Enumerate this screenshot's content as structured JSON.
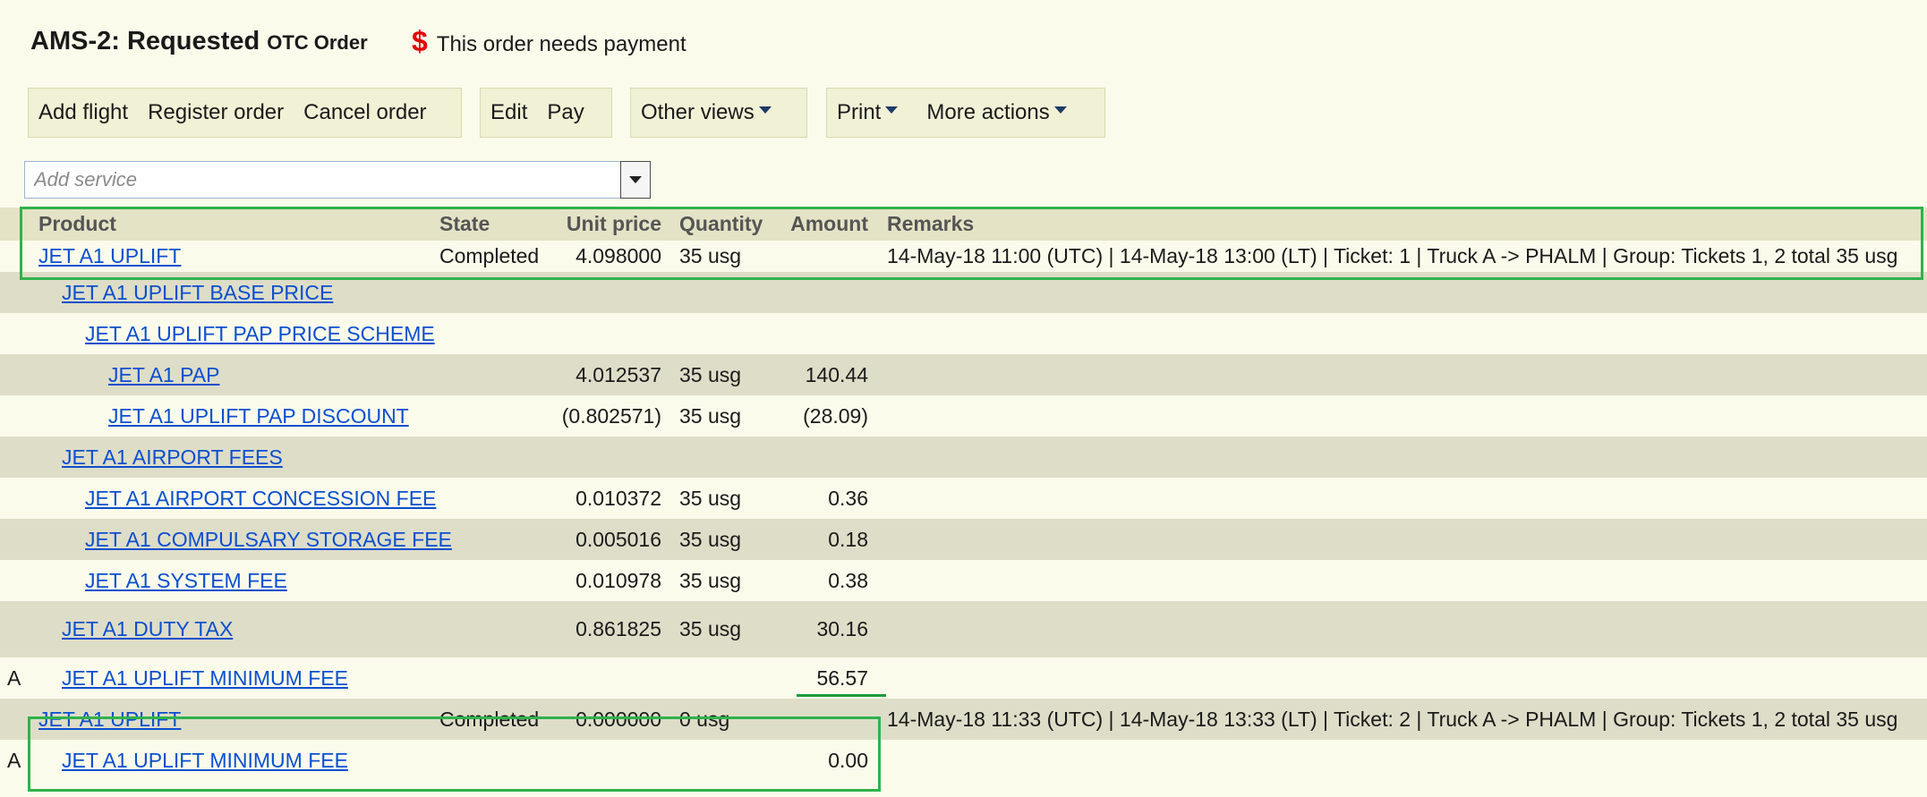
{
  "header": {
    "title": "AMS-2: Requested",
    "title_suffix": "OTC Order",
    "notice_icon": "$",
    "notice": "This order needs payment"
  },
  "toolbar": {
    "group1": [
      "Add flight",
      "Register order",
      "Cancel order"
    ],
    "group2": [
      "Edit",
      "Pay"
    ],
    "other_views": "Other views",
    "print": "Print",
    "more_actions": "More actions"
  },
  "add_service": {
    "placeholder": "Add service"
  },
  "table": {
    "headers": {
      "product": "Product",
      "state": "State",
      "unit_price": "Unit price",
      "quantity": "Quantity",
      "amount": "Amount",
      "remarks": "Remarks"
    },
    "rows": [
      {
        "flag": "",
        "product": "JET A1 UPLIFT",
        "indent": 0,
        "state": "Completed",
        "unit_price": "4.098000",
        "quantity": "35 usg",
        "amount": "",
        "remarks": "14-May-18 11:00 (UTC) | 14-May-18 13:00 (LT) | Ticket: 1 | Truck A -> PHALM | Group: Tickets 1, 2 total 35 usg"
      },
      {
        "flag": "",
        "product": "JET A1 UPLIFT BASE PRICE",
        "indent": 1,
        "state": "",
        "unit_price": "",
        "quantity": "",
        "amount": "",
        "remarks": ""
      },
      {
        "flag": "",
        "product": "JET A1 UPLIFT PAP PRICE SCHEME",
        "indent": 2,
        "state": "",
        "unit_price": "",
        "quantity": "",
        "amount": "",
        "remarks": ""
      },
      {
        "flag": "",
        "product": "JET A1 PAP",
        "indent": 3,
        "state": "",
        "unit_price": "4.012537",
        "quantity": "35 usg",
        "amount": "140.44",
        "remarks": ""
      },
      {
        "flag": "",
        "product": "JET A1 UPLIFT PAP DISCOUNT",
        "indent": 3,
        "state": "",
        "unit_price": "(0.802571)",
        "quantity": "35 usg",
        "amount": "(28.09)",
        "remarks": ""
      },
      {
        "flag": "",
        "product": "JET A1 AIRPORT FEES",
        "indent": 1,
        "state": "",
        "unit_price": "",
        "quantity": "",
        "amount": "",
        "remarks": ""
      },
      {
        "flag": "",
        "product": "JET A1 AIRPORT CONCESSION FEE",
        "indent": 2,
        "state": "",
        "unit_price": "0.010372",
        "quantity": "35 usg",
        "amount": "0.36",
        "remarks": ""
      },
      {
        "flag": "",
        "product": "JET A1 COMPULSARY STORAGE FEE",
        "indent": 2,
        "state": "",
        "unit_price": "0.005016",
        "quantity": "35 usg",
        "amount": "0.18",
        "remarks": ""
      },
      {
        "flag": "",
        "product": "JET A1 SYSTEM FEE",
        "indent": 2,
        "state": "",
        "unit_price": "0.010978",
        "quantity": "35 usg",
        "amount": "0.38",
        "remarks": ""
      },
      {
        "flag": "",
        "product": "JET A1 DUTY TAX",
        "indent": 1,
        "state": "",
        "unit_price": "0.861825",
        "quantity": "35 usg",
        "amount": "30.16",
        "remarks": ""
      },
      {
        "flag": "A",
        "product": "JET A1 UPLIFT MINIMUM FEE",
        "indent": 1,
        "state": "",
        "unit_price": "",
        "quantity": "",
        "amount": "56.57",
        "remarks": ""
      },
      {
        "flag": "",
        "product": "JET A1 UPLIFT",
        "indent": 0,
        "state": "Completed",
        "unit_price": "0.000000",
        "quantity": "0 usg",
        "amount": "",
        "remarks": "14-May-18 11:33 (UTC) | 14-May-18 13:33 (LT) | Ticket: 2 | Truck A -> PHALM | Group: Tickets 1, 2 total 35 usg"
      },
      {
        "flag": "A",
        "product": "JET A1 UPLIFT MINIMUM FEE",
        "indent": 1,
        "state": "",
        "unit_price": "",
        "quantity": "",
        "amount": "0.00",
        "remarks": ""
      }
    ]
  },
  "colors": {
    "background": "#fbfbec",
    "row_alt": "#deddc8",
    "link": "#0b4fcf",
    "highlight": "#2fb24b",
    "notice": "#e00000"
  }
}
